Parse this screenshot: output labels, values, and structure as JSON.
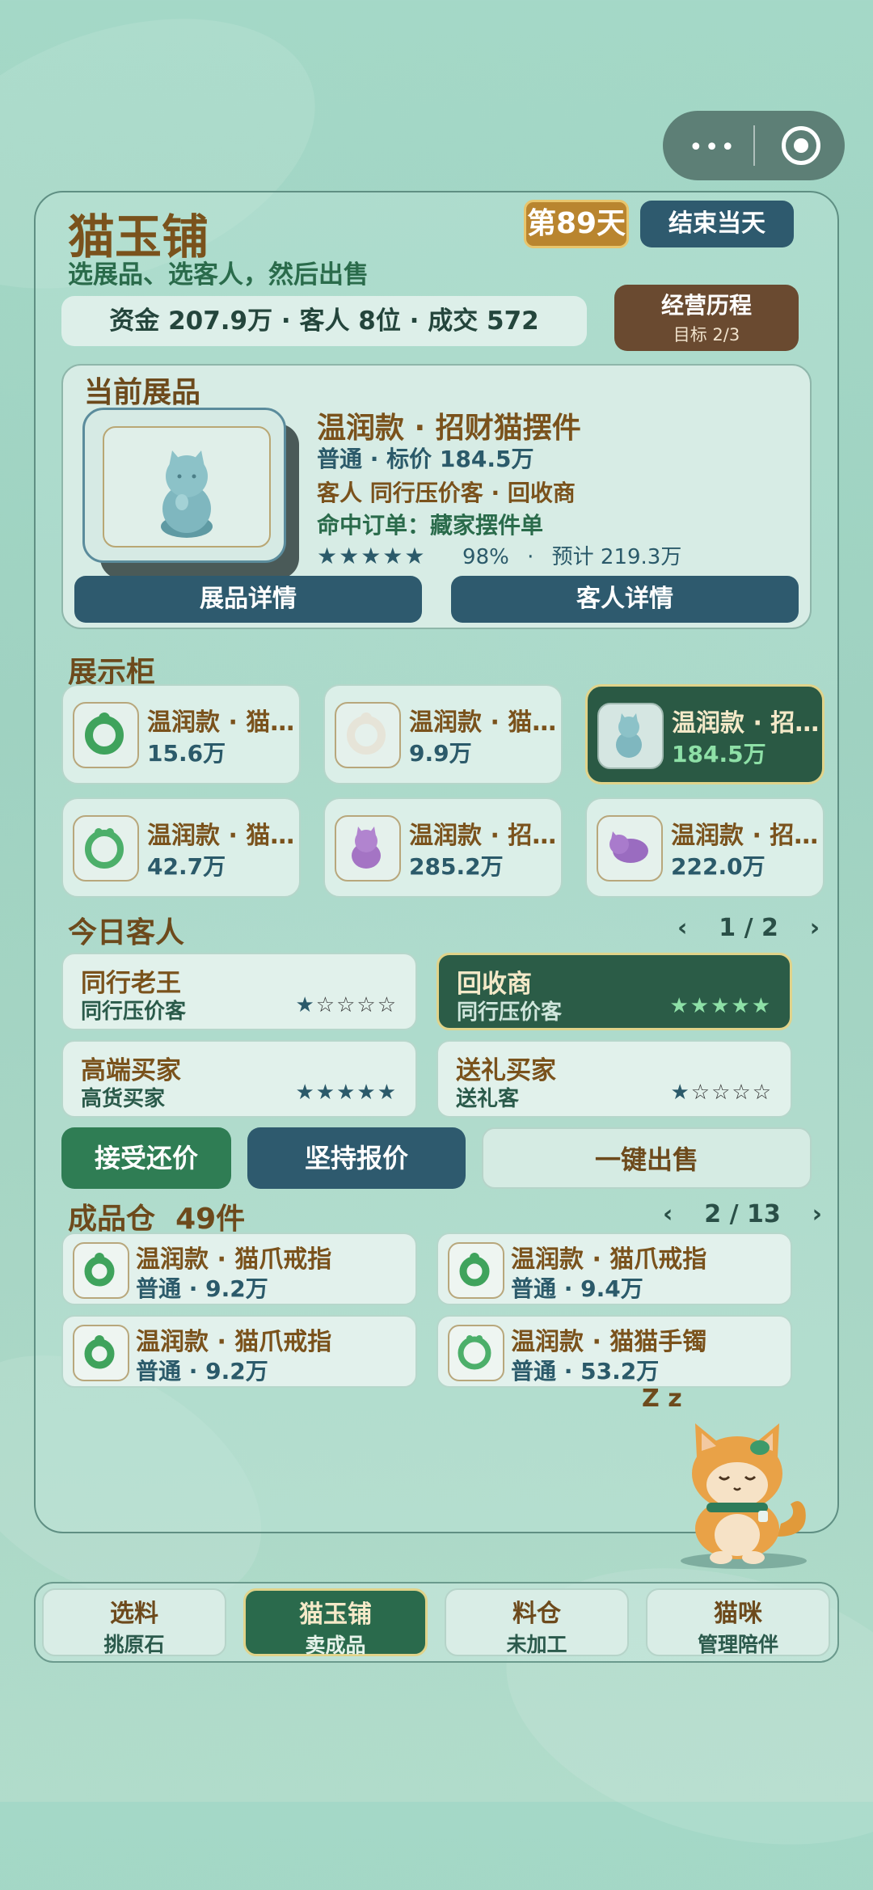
{
  "header": {
    "title": "猫玉铺",
    "subtitle": "选展品、选客人，然后出售",
    "day_badge": "第89天",
    "end_day_button": "结束当天",
    "stats": "资金 207.9万 · 客人 8位 · 成交 572",
    "history_button": "经营历程",
    "history_goal": "目标 2/3"
  },
  "current_item": {
    "section_title": "当前展品",
    "name": "温润款 · 招财猫摆件",
    "grade_price": "普通 · 标价 184.5万",
    "customer": "客人 同行压价客 · 回收商",
    "order_hit": "命中订单：藏家摆件单",
    "stars": "★★★★★",
    "percent": "98%",
    "estimate": "预计 219.3万",
    "detail_button": "展品详情",
    "customer_button": "客人详情"
  },
  "showcase": {
    "title": "展示柜",
    "items": [
      {
        "name": "温润款 · 猫爪戒指",
        "price": "15.6万",
        "icon": "green-ring-icon"
      },
      {
        "name": "温润款 · 猫爪戒指",
        "price": "9.9万",
        "icon": "white-ring-icon"
      },
      {
        "name": "温润款 · 招财猫摆件",
        "price": "184.5万",
        "icon": "blue-cat-figurine-icon",
        "selected": true
      },
      {
        "name": "温润款 · 猫猫手镯",
        "price": "42.7万",
        "icon": "green-bangle-icon"
      },
      {
        "name": "温润款 · 招财猫摆件",
        "price": "285.2万",
        "icon": "purple-cat-figurine-icon"
      },
      {
        "name": "温润款 · 招财猫摆件",
        "price": "222.0万",
        "icon": "purple-cat-figurine-icon"
      }
    ]
  },
  "customers": {
    "title": "今日客人",
    "pager": "1 / 2",
    "prev": "‹",
    "next": "›",
    "list": [
      {
        "name": "同行老王",
        "type": "同行压价客",
        "rating": 1
      },
      {
        "name": "回收商",
        "type": "同行压价客",
        "rating": 5,
        "selected": true
      },
      {
        "name": "高端买家",
        "type": "高货买家",
        "rating": 5
      },
      {
        "name": "送礼买家",
        "type": "送礼客",
        "rating": 1
      }
    ]
  },
  "actions": {
    "accept": "接受还价",
    "insist": "坚持报价",
    "sell_all": "一键出售"
  },
  "inventory": {
    "title": "成品仓  49件",
    "pager": "2 / 13",
    "prev": "‹",
    "next": "›",
    "items": [
      {
        "name": "温润款 · 猫爪戒指",
        "info": "普通 · 9.2万"
      },
      {
        "name": "温润款 · 猫爪戒指",
        "info": "普通 · 9.4万"
      },
      {
        "name": "温润款 · 猫爪戒指",
        "info": "普通 · 9.2万"
      },
      {
        "name": "温润款 · 猫猫手镯",
        "info": "普通 · 53.2万"
      }
    ]
  },
  "mascot": {
    "sleep": "Z z"
  },
  "tabs": [
    {
      "label": "选料",
      "sub": "挑原石"
    },
    {
      "label": "猫玉铺",
      "sub": "卖成品",
      "active": true
    },
    {
      "label": "料仓",
      "sub": "未加工"
    },
    {
      "label": "猫咪",
      "sub": "管理陪伴"
    }
  ],
  "colors": {
    "accent_green": "#2a6a4c",
    "accent_blue": "#2e5a6e",
    "brown": "#7a521c",
    "gold": "#b9852f"
  }
}
